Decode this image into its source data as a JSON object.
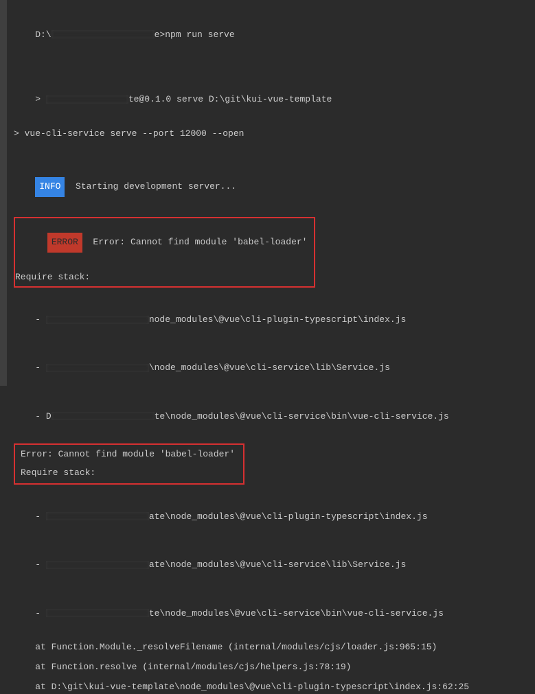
{
  "prompt": {
    "drive": "D:\\",
    "suffix": "e>",
    "command": "npm run serve"
  },
  "preRun": {
    "prefix": "> ",
    "scriptSuffix": "te@0.1.0 serve D:\\git\\kui-vue-template",
    "serveLine": "> vue-cli-service serve --port 12000 --open"
  },
  "info": {
    "badge": "INFO",
    "text": "  Starting development server..."
  },
  "errorBox1": {
    "badge": "ERROR",
    "errorLine": "  Error: Cannot find module 'babel-loader'",
    "requireLine": "Require stack:"
  },
  "stack1": {
    "prefix": "- ",
    "suffix1": "node_modules\\@vue\\cli-plugin-typescript\\index.js",
    "suffix2": "\\node_modules\\@vue\\cli-service\\lib\\Service.js",
    "line3prefix": "- D",
    "line3mid": "te\\node_modules\\@vue\\cli-service\\bin\\vue-cli-service.js"
  },
  "errorBox2": {
    "errorLine": "Error: Cannot find module 'babel-loader'",
    "requireLine": "Require stack:"
  },
  "stack2": {
    "prefix": "- ",
    "suffix1": "ate\\node_modules\\@vue\\cli-plugin-typescript\\index.js",
    "suffix2": "ate\\node_modules\\@vue\\cli-service\\lib\\Service.js",
    "suffix3": "te\\node_modules\\@vue\\cli-service\\bin\\vue-cli-service.js"
  },
  "trace": {
    "line1": "    at Function.Module._resolveFilename (internal/modules/cjs/loader.js:965:15)",
    "line2": "    at Function.resolve (internal/modules/cjs/helpers.js:78:19)",
    "line3": "    at D:\\git\\kui-vue-template\\node_modules\\@vue\\cli-plugin-typescript\\index.js:62:25"
  }
}
